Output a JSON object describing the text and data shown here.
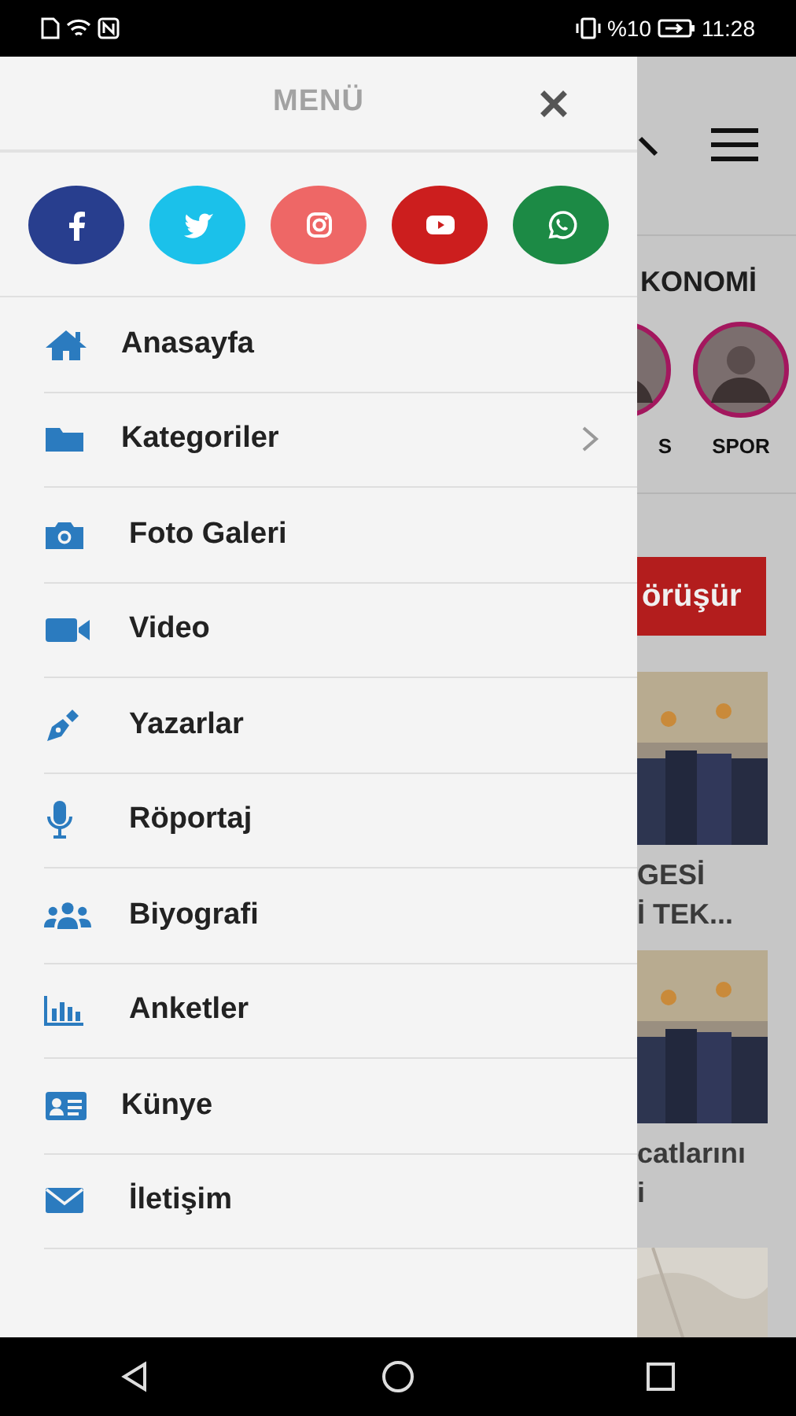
{
  "status_bar": {
    "battery": "%10",
    "time": "11:28"
  },
  "background": {
    "tab": "KONOMİ",
    "stories": [
      {
        "label": "S"
      },
      {
        "label": "SPOR"
      }
    ],
    "button": "örüşür",
    "news": [
      {
        "lines": [
          "GESİ",
          "İ TEK..."
        ]
      },
      {
        "lines": [
          "catlarını",
          "i"
        ]
      }
    ]
  },
  "menu": {
    "title": "MENÜ",
    "social": [
      {
        "kind": "facebook",
        "color": "#283e8e"
      },
      {
        "kind": "twitter",
        "color": "#1bc1ea"
      },
      {
        "kind": "instagram",
        "color": "#ee6766"
      },
      {
        "kind": "youtube",
        "color": "#cc1e1e"
      },
      {
        "kind": "whatsapp",
        "color": "#1c8a45"
      }
    ],
    "items": [
      {
        "label": "Anasayfa",
        "kind": "home",
        "has_submenu": false
      },
      {
        "label": "Kategoriler",
        "kind": "folder",
        "has_submenu": true
      },
      {
        "label": "Foto Galeri",
        "kind": "camera",
        "has_submenu": false
      },
      {
        "label": "Video",
        "kind": "video",
        "has_submenu": false
      },
      {
        "label": "Yazarlar",
        "kind": "pen",
        "has_submenu": false
      },
      {
        "label": "Röportaj",
        "kind": "mic",
        "has_submenu": false
      },
      {
        "label": "Biyografi",
        "kind": "users",
        "has_submenu": false
      },
      {
        "label": "Anketler",
        "kind": "chart",
        "has_submenu": false
      },
      {
        "label": "Künye",
        "kind": "idcard",
        "has_submenu": false
      },
      {
        "label": "İletişim",
        "kind": "envelope",
        "has_submenu": false
      }
    ]
  }
}
